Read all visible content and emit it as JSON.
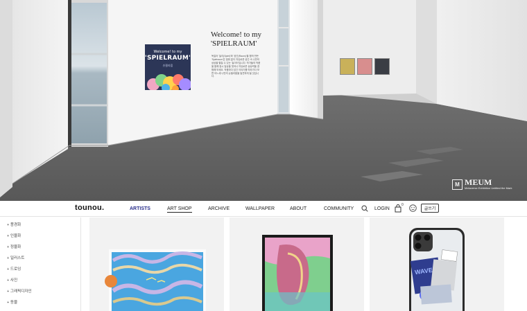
{
  "hero": {
    "poster": {
      "line1": "Welcome! to my",
      "line2": "'SPIELRAUM'",
      "line3": "슈필라움"
    },
    "wall_title_line1": "Welcome! to my",
    "wall_title_line2": "'SPIELRAUM'",
    "wall_body": "독일어 '놀이(Spiel)'와 '공간(Raum)'을 합쳐 만든 'Spielraum'은 범위 없이 자유로운 공간 속 나만의 상상을 펼칠 수 있는 '놀이터'입니다. 작가들의 작품을 통해 잠시 일상을 벗어나 자유로운 상상력을 경험해 보세요. 작품마다 담긴 이야기를 따라가다 보면 어느새 나만의 슈필라움을 발견하게 될 것입니다.",
    "watermark_title": "MEUM",
    "watermark_sub": "Metaverse Exhibition Untitled the Mark",
    "mini_colors": [
      "#c9b15a",
      "#d88e8e",
      "#3a3d44"
    ]
  },
  "nav": {
    "logo": "tounou.",
    "items": [
      "ARTISTS",
      "ART SHOP",
      "ARCHIVE",
      "WALLPAPER",
      "ABOUT",
      "COMMUNITY"
    ],
    "active_item": "ARTISTS",
    "underlined_item": "ART SHOP",
    "login": "LOGIN",
    "cart_count": "0",
    "write_button": "글쓰기",
    "accent": "#2a2f8c"
  },
  "sidebar": {
    "categories": [
      "+ 풍경화",
      "+ 인물화",
      "+ 정물화",
      "+ 일러스트",
      "+ 드로잉",
      "+ 사진",
      "+ 그래픽디자인",
      "+ 동물"
    ]
  },
  "products": [
    {
      "kind": "print",
      "icon": "artwork-thumbnail"
    },
    {
      "kind": "framed-print",
      "icon": "artwork-thumbnail"
    },
    {
      "kind": "phone-case",
      "icon": "phone-case-thumbnail"
    }
  ]
}
